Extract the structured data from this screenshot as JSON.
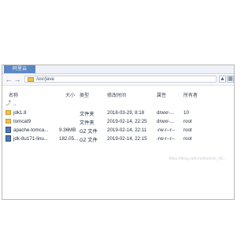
{
  "tab": {
    "label": "阿里云"
  },
  "address": {
    "path": "/usr/java"
  },
  "columns": {
    "name": "名称",
    "size": "大小",
    "type": "类型",
    "modified": "修改时间",
    "attr": "属性",
    "owner": "所有者"
  },
  "files": [
    {
      "name": "..",
      "size": "",
      "type": "",
      "modified": "",
      "attr": "",
      "owner": "",
      "kind": "up"
    },
    {
      "name": "jdk1.8",
      "size": "",
      "type": "文件夹",
      "modified": "2018-03-29, 8:18",
      "attr": "drwxr-...",
      "owner": "10",
      "kind": "folder"
    },
    {
      "name": "tomcat9",
      "size": "",
      "type": "文件夹",
      "modified": "2019-02-14, 22:25",
      "attr": "drwxr-...",
      "owner": "root",
      "kind": "folder"
    },
    {
      "name": "apache-tomca...",
      "size": "9.36MB",
      "type": "GZ 文件",
      "modified": "2019-02-14, 22:11",
      "attr": "-rw-r--r--",
      "owner": "root",
      "kind": "file"
    },
    {
      "name": "jdk-8u171-linu...",
      "size": "182.05...",
      "type": "GZ 文件",
      "modified": "2019-02-14, 22:15",
      "attr": "-rw-r--r--",
      "owner": "root",
      "kind": "file"
    }
  ],
  "watermark": "https://blog.csdn.net/weixin_43..."
}
